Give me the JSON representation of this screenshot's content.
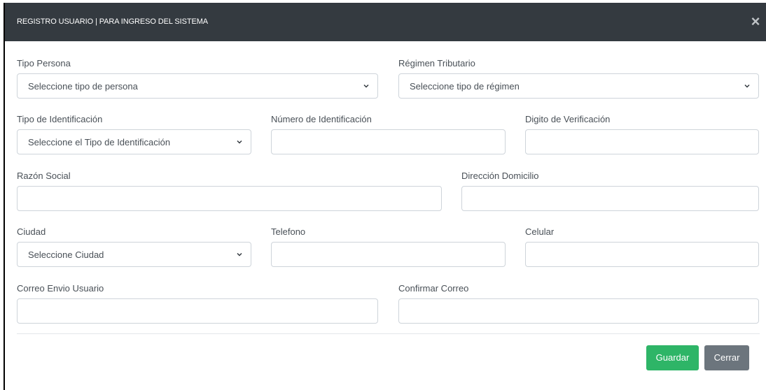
{
  "header": {
    "title": "REGISTRO USUARIO  |  PARA INGRESO DEL SISTEMA",
    "close_icon": "close-icon"
  },
  "form": {
    "tipo_persona": {
      "label": "Tipo Persona",
      "selected": "Seleccione tipo de persona"
    },
    "regimen_tributario": {
      "label": "Régimen Tributario",
      "selected": "Seleccione tipo de régimen"
    },
    "tipo_identificacion": {
      "label": "Tipo de Identificación",
      "selected": "Seleccione el Tipo de Identificación"
    },
    "numero_identificacion": {
      "label": "Número de Identificación",
      "value": ""
    },
    "digito_verificacion": {
      "label": "Digito de Verificación",
      "value": ""
    },
    "razon_social": {
      "label": "Razón Social",
      "value": ""
    },
    "direccion_domicilio": {
      "label": "Dirección Domicilio",
      "value": ""
    },
    "ciudad": {
      "label": "Ciudad",
      "selected": "Seleccione Ciudad"
    },
    "telefono": {
      "label": "Telefono",
      "value": ""
    },
    "celular": {
      "label": "Celular",
      "value": ""
    },
    "correo_envio": {
      "label": "Correo Envio Usuario",
      "value": ""
    },
    "confirmar_correo": {
      "label": "Confirmar Correo",
      "value": ""
    }
  },
  "footer": {
    "save_label": "Guardar",
    "close_label": "Cerrar"
  },
  "colors": {
    "header_bg": "#343a40",
    "save_button": "#2eb567",
    "close_button": "#6c757d"
  }
}
